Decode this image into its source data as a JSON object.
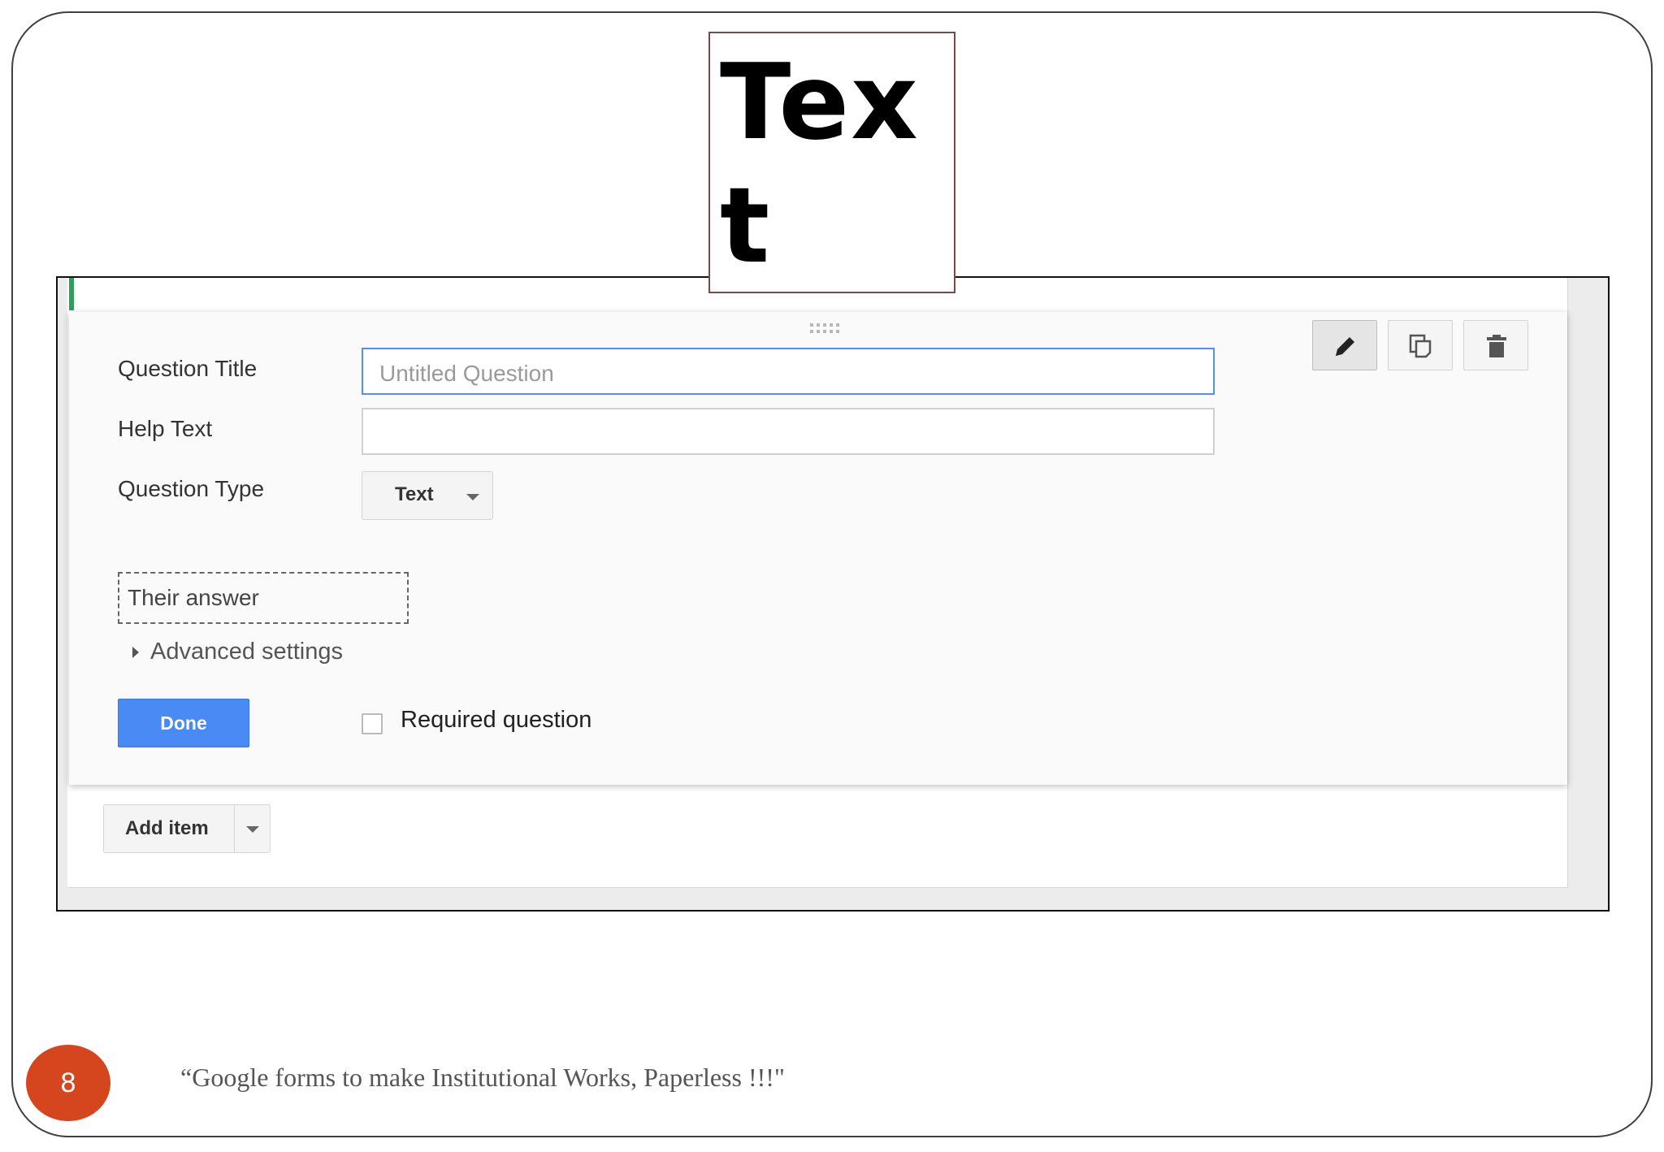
{
  "slide": {
    "big_label": "Text",
    "page_number": "8",
    "footer": "“Google forms to make Institutional Works, Paperless !!!\""
  },
  "form": {
    "question_title_label": "Question Title",
    "question_title_placeholder": "Untitled Question",
    "help_text_label": "Help Text",
    "help_text_value": "",
    "question_type_label": "Question Type",
    "question_type_value": "Text",
    "answer_preview": "Their answer",
    "advanced_settings": "Advanced settings",
    "done_label": "Done",
    "required_label": "Required question",
    "required_checked": false
  },
  "toolbar": {
    "edit_icon": "pencil-icon",
    "duplicate_icon": "copy-icon",
    "delete_icon": "trash-icon"
  },
  "footer_actions": {
    "add_item_label": "Add item"
  },
  "colors": {
    "done_button": "#4a8af4",
    "focus_border": "#4d90fe",
    "page_badge": "#d5451e",
    "accent_green": "#2e9e5b"
  }
}
